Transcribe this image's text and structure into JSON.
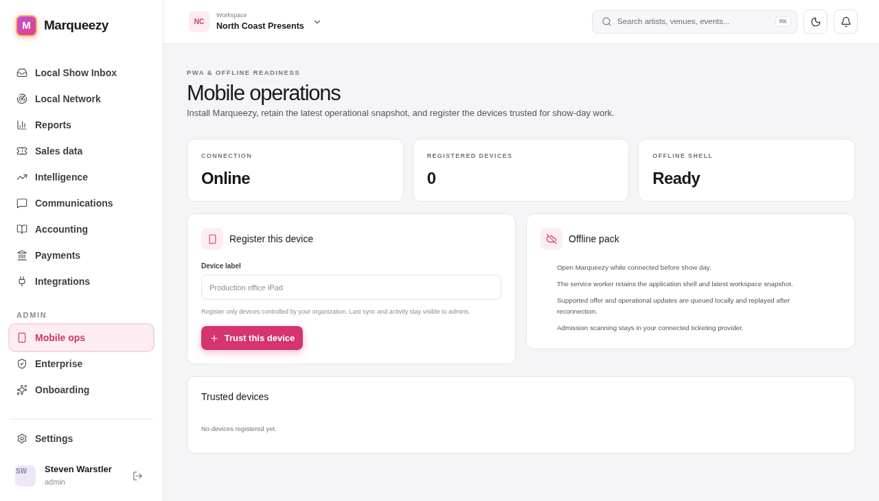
{
  "sidebar": {
    "brand": {
      "logo_letter": "M",
      "name": "Marqueezy"
    },
    "nav_items": [
      {
        "label": "Local Show Inbox",
        "selected": false
      },
      {
        "label": "Local Network",
        "selected": false
      },
      {
        "label": "Reports",
        "selected": false
      },
      {
        "label": "Sales data",
        "selected": false
      },
      {
        "label": "Intelligence",
        "selected": false
      },
      {
        "label": "Communications",
        "selected": false
      },
      {
        "label": "Accounting",
        "selected": false
      },
      {
        "label": "Payments",
        "selected": false
      },
      {
        "label": "Integrations",
        "selected": false
      }
    ],
    "admin_section": {
      "heading": "ADMIN",
      "items": [
        {
          "label": "Mobile ops",
          "selected": true
        },
        {
          "label": "Enterprise",
          "selected": false
        },
        {
          "label": "Onboarding",
          "selected": false
        }
      ]
    },
    "settings": {
      "label": "Settings",
      "selected": false
    },
    "user": {
      "initials": "SW",
      "name": "Steven Warstler",
      "role": "admin"
    }
  },
  "topbar": {
    "workspace": {
      "initials": "NC",
      "caption": "Workspace",
      "name": "North Coast Presents"
    },
    "search": {
      "placeholder": "Search artists, venues, events...",
      "shortcut": "⌘K"
    }
  },
  "page": {
    "eyebrow": "PWA & OFFLINE READINESS",
    "title": "Mobile operations",
    "description": "Install Marqueezy, retain the latest operational snapshot, and register the devices trusted for show-day work."
  },
  "stats": [
    {
      "label": "CONNECTION",
      "value": "Online"
    },
    {
      "label": "REGISTERED DEVICES",
      "value": "0"
    },
    {
      "label": "OFFLINE SHELL",
      "value": "Ready"
    }
  ],
  "register_card": {
    "title": "Register this device",
    "field_label": "Device label",
    "placeholder": "Production office iPad",
    "help": "Register only devices controlled by your organization. Last sync and activity stay visible to admins.",
    "button": "Trust this device"
  },
  "offline_pack": {
    "title": "Offline pack",
    "items": [
      "Open Marqueezy while connected before show day.",
      "The service worker retains the application shell and latest workspace snapshot.",
      "Supported offer and operational updates are queued locally and replayed after reconnection.",
      "Admission scanning stays in your connected ticketing provider."
    ]
  },
  "trusted_devices": {
    "title": "Trusted devices",
    "empty_text": "No devices registered yet."
  }
}
